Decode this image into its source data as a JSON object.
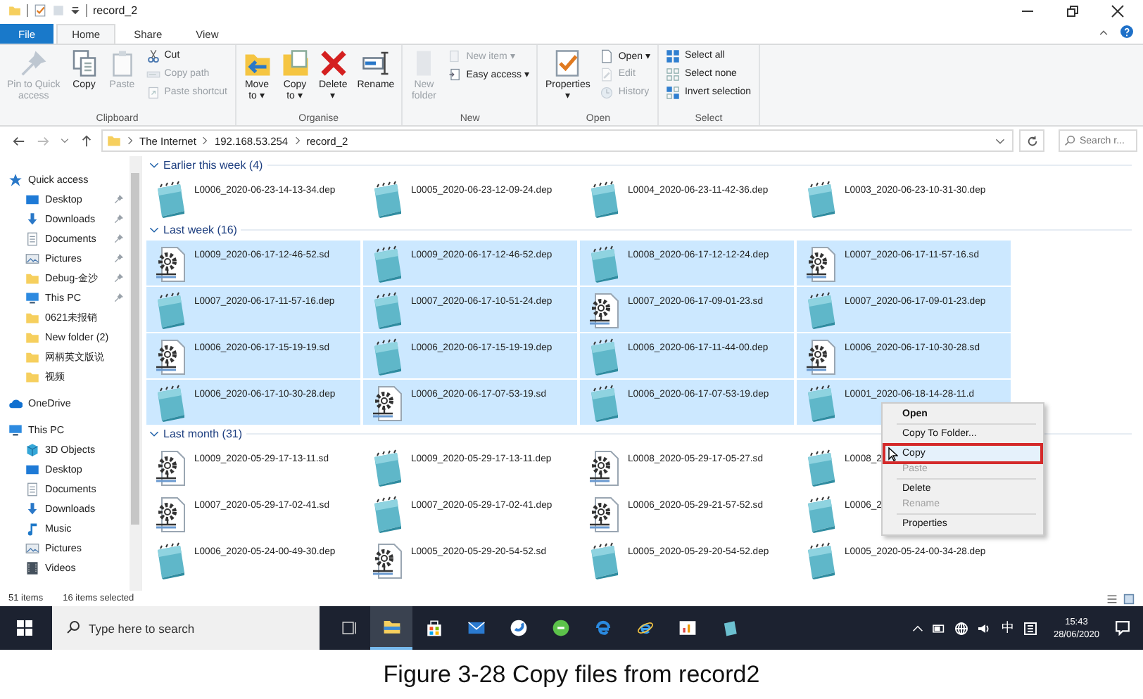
{
  "window": {
    "title": "record_2"
  },
  "tabs": [
    {
      "label": "File",
      "kind": "menu",
      "selected": false
    },
    {
      "label": "Home",
      "kind": "tab",
      "selected": true
    },
    {
      "label": "Share",
      "kind": "tab",
      "selected": false
    },
    {
      "label": "View",
      "kind": "tab",
      "selected": false
    }
  ],
  "ribbon": {
    "groups": [
      {
        "label": "Clipboard",
        "large": [
          {
            "lines": [
              "Pin to Quick",
              "access"
            ],
            "kind": "pin",
            "disabled": true
          },
          {
            "lines": [
              "Copy"
            ],
            "kind": "copy",
            "disabled": false
          },
          {
            "lines": [
              "Paste"
            ],
            "kind": "paste",
            "disabled": true
          }
        ],
        "small": [
          {
            "label": "Cut",
            "kind": "cut",
            "disabled": false
          },
          {
            "label": "Copy path",
            "kind": "copy-path",
            "disabled": true
          },
          {
            "label": "Paste shortcut",
            "kind": "paste-shortcut",
            "disabled": true
          }
        ]
      },
      {
        "label": "Organise",
        "large": [
          {
            "lines": [
              "Move",
              "to ▾"
            ],
            "kind": "move",
            "disabled": false
          },
          {
            "lines": [
              "Copy",
              "to ▾"
            ],
            "kind": "copy-to",
            "disabled": false
          },
          {
            "lines": [
              "Delete",
              "▾"
            ],
            "kind": "delete",
            "disabled": false
          },
          {
            "lines": [
              "Rename"
            ],
            "kind": "rename",
            "disabled": false
          }
        ]
      },
      {
        "label": "New",
        "large": [
          {
            "lines": [
              "New",
              "folder"
            ],
            "kind": "new-folder",
            "disabled": true
          }
        ],
        "small": [
          {
            "label": "New item ▾",
            "kind": "new-item",
            "disabled": true
          },
          {
            "label": "Easy access ▾",
            "kind": "easy-access",
            "disabled": false
          }
        ]
      },
      {
        "label": "Open",
        "large": [
          {
            "lines": [
              "Properties",
              "▾"
            ],
            "kind": "properties",
            "disabled": false
          }
        ],
        "small": [
          {
            "label": "Open ▾",
            "kind": "open",
            "disabled": false
          },
          {
            "label": "Edit",
            "kind": "edit",
            "disabled": true
          },
          {
            "label": "History",
            "kind": "history",
            "disabled": true
          }
        ]
      },
      {
        "label": "Select",
        "small": [
          {
            "label": "Select all",
            "kind": "select-all",
            "disabled": false
          },
          {
            "label": "Select none",
            "kind": "select-none",
            "disabled": false
          },
          {
            "label": "Invert selection",
            "kind": "invert",
            "disabled": false
          }
        ]
      }
    ]
  },
  "address": {
    "crumbs": [
      "The Internet",
      "192.168.53.254",
      "record_2"
    ]
  },
  "search": {
    "placeholder": "Search r..."
  },
  "sidebar": [
    {
      "label": "Quick access",
      "kind": "quick",
      "pinned": false,
      "children": [
        {
          "label": "Desktop",
          "kind": "desktop",
          "pinned": true
        },
        {
          "label": "Downloads",
          "kind": "downloads",
          "pinned": true
        },
        {
          "label": "Documents",
          "kind": "documents",
          "pinned": true
        },
        {
          "label": "Pictures",
          "kind": "pictures",
          "pinned": true
        },
        {
          "label": "Debug-金沙",
          "kind": "folder",
          "pinned": true
        },
        {
          "label": "This PC",
          "kind": "pc",
          "pinned": true
        },
        {
          "label": "0621未报销",
          "kind": "folder",
          "pinned": false
        },
        {
          "label": "New folder (2)",
          "kind": "folder",
          "pinned": false
        },
        {
          "label": "网柄英文版说",
          "kind": "folder",
          "pinned": false
        },
        {
          "label": "视频",
          "kind": "folder",
          "pinned": false
        }
      ]
    },
    {
      "label": "OneDrive",
      "kind": "onedrive",
      "pinned": false
    },
    {
      "label": "This PC",
      "kind": "pc",
      "pinned": false,
      "children": [
        {
          "label": "3D Objects",
          "kind": "objects",
          "pinned": false
        },
        {
          "label": "Desktop",
          "kind": "desktop",
          "pinned": false
        },
        {
          "label": "Documents",
          "kind": "documents",
          "pinned": false
        },
        {
          "label": "Downloads",
          "kind": "downloads",
          "pinned": false
        },
        {
          "label": "Music",
          "kind": "music",
          "pinned": false
        },
        {
          "label": "Pictures",
          "kind": "pictures",
          "pinned": false
        },
        {
          "label": "Videos",
          "kind": "videos",
          "pinned": false
        }
      ]
    }
  ],
  "sections": [
    {
      "title": "Earlier this week (4)",
      "items": [
        {
          "name": "L0006_2020-06-23-14-13-34.dep",
          "kind": "dep",
          "selected": false
        },
        {
          "name": "L0005_2020-06-23-12-09-24.dep",
          "kind": "dep",
          "selected": false
        },
        {
          "name": "L0004_2020-06-23-11-42-36.dep",
          "kind": "dep",
          "selected": false
        },
        {
          "name": "L0003_2020-06-23-10-31-30.dep",
          "kind": "dep",
          "selected": false
        }
      ]
    },
    {
      "title": "Last week (16)",
      "items": [
        {
          "name": "L0009_2020-06-17-12-46-52.sd",
          "kind": "sd",
          "selected": true
        },
        {
          "name": "L0009_2020-06-17-12-46-52.dep",
          "kind": "dep",
          "selected": true
        },
        {
          "name": "L0008_2020-06-17-12-12-24.dep",
          "kind": "dep",
          "selected": true
        },
        {
          "name": "L0007_2020-06-17-11-57-16.sd",
          "kind": "sd",
          "selected": true
        },
        {
          "name": "L0007_2020-06-17-11-57-16.dep",
          "kind": "dep",
          "selected": true
        },
        {
          "name": "L0007_2020-06-17-10-51-24.dep",
          "kind": "dep",
          "selected": true
        },
        {
          "name": "L0007_2020-06-17-09-01-23.sd",
          "kind": "sd",
          "selected": true
        },
        {
          "name": "L0007_2020-06-17-09-01-23.dep",
          "kind": "dep",
          "selected": true
        },
        {
          "name": "L0006_2020-06-17-15-19-19.sd",
          "kind": "sd",
          "selected": true
        },
        {
          "name": "L0006_2020-06-17-15-19-19.dep",
          "kind": "dep",
          "selected": true
        },
        {
          "name": "L0006_2020-06-17-11-44-00.dep",
          "kind": "dep",
          "selected": true
        },
        {
          "name": "L0006_2020-06-17-10-30-28.sd",
          "kind": "sd",
          "selected": true
        },
        {
          "name": "L0006_2020-06-17-10-30-28.dep",
          "kind": "dep",
          "selected": true
        },
        {
          "name": "L0006_2020-06-17-07-53-19.sd",
          "kind": "sd",
          "selected": true
        },
        {
          "name": "L0006_2020-06-17-07-53-19.dep",
          "kind": "dep",
          "selected": true
        },
        {
          "name": "L0001_2020-06-18-14-28-11.d",
          "kind": "dep",
          "selected": true
        }
      ]
    },
    {
      "title": "Last month (31)",
      "items": [
        {
          "name": "L0009_2020-05-29-17-13-11.sd",
          "kind": "sd",
          "selected": false
        },
        {
          "name": "L0009_2020-05-29-17-13-11.dep",
          "kind": "dep",
          "selected": false
        },
        {
          "name": "L0008_2020-05-29-17-05-27.sd",
          "kind": "sd",
          "selected": false
        },
        {
          "name": "L0008_2",
          "kind": "dep",
          "selected": false
        },
        {
          "name": "L0007_2020-05-29-17-02-41.sd",
          "kind": "sd",
          "selected": false
        },
        {
          "name": "L0007_2020-05-29-17-02-41.dep",
          "kind": "dep",
          "selected": false
        },
        {
          "name": "L0006_2020-05-29-21-57-52.sd",
          "kind": "sd",
          "selected": false
        },
        {
          "name": "L0006_2",
          "kind": "dep",
          "selected": false
        },
        {
          "name": "L0006_2020-05-24-00-49-30.dep",
          "kind": "dep",
          "selected": false
        },
        {
          "name": "L0005_2020-05-29-20-54-52.sd",
          "kind": "sd",
          "selected": false
        },
        {
          "name": "L0005_2020-05-29-20-54-52.dep",
          "kind": "dep",
          "selected": false
        },
        {
          "name": "L0005_2020-05-24-00-34-28.dep",
          "kind": "dep",
          "selected": false
        }
      ]
    }
  ],
  "context_menu": [
    {
      "label": "Open",
      "kind": "default",
      "disabled": false,
      "selected": false
    },
    {
      "kind": "separator"
    },
    {
      "label": "Copy To Folder...",
      "kind": "item",
      "disabled": false,
      "selected": false
    },
    {
      "kind": "separator"
    },
    {
      "label": "Copy",
      "kind": "item",
      "disabled": false,
      "selected": true
    },
    {
      "label": "Paste",
      "kind": "item",
      "disabled": true,
      "selected": false
    },
    {
      "kind": "separator"
    },
    {
      "label": "Delete",
      "kind": "item",
      "disabled": false,
      "selected": false
    },
    {
      "label": "Rename",
      "kind": "item",
      "disabled": true,
      "selected": false
    },
    {
      "kind": "separator"
    },
    {
      "label": "Properties",
      "kind": "item",
      "disabled": false,
      "selected": false
    }
  ],
  "status_bar": {
    "items": "51 items",
    "selected": "16 items selected"
  },
  "taskbar": {
    "search_placeholder": "Type here to search",
    "apps": [
      {
        "kind": "task-view",
        "active": false
      },
      {
        "kind": "explorer",
        "active": true
      },
      {
        "kind": "store",
        "active": false
      },
      {
        "kind": "mail",
        "active": false
      },
      {
        "kind": "circle-blue",
        "active": false
      },
      {
        "kind": "circle-green",
        "active": false
      },
      {
        "kind": "edge",
        "active": false
      },
      {
        "kind": "ie",
        "active": false
      },
      {
        "kind": "chart",
        "active": false
      },
      {
        "kind": "notepad",
        "active": false
      }
    ],
    "ime": "中",
    "time": "15:43",
    "date": "28/06/2020"
  },
  "caption": "Figure 3-28 Copy files from record2"
}
